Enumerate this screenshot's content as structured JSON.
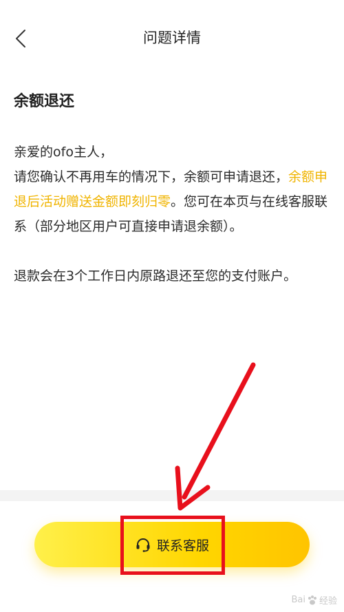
{
  "header": {
    "title": "问题详情",
    "back_icon": "chevron-left-icon"
  },
  "article": {
    "title": "余额退还",
    "greeting": "亲爱的ofo主人，",
    "line1": "请您确认不再用车的情况下，余额可申请退还，",
    "highlight": "余额申退后活动赠送金额即刻归零",
    "after_highlight": "。您可在本页与在线客服联系（部分地区用户可直接申请退余额）。",
    "refund_note": "退款会在3个工作日内原路退还至您的支付账户。"
  },
  "footer": {
    "contact_label": "联系客服",
    "contact_icon": "headset-icon"
  },
  "watermark": {
    "text_left": "Bai",
    "text_right": "经验"
  },
  "colors": {
    "accent": "#ffd600",
    "highlight_text": "#f0b400",
    "annotation": "#e8101c"
  }
}
